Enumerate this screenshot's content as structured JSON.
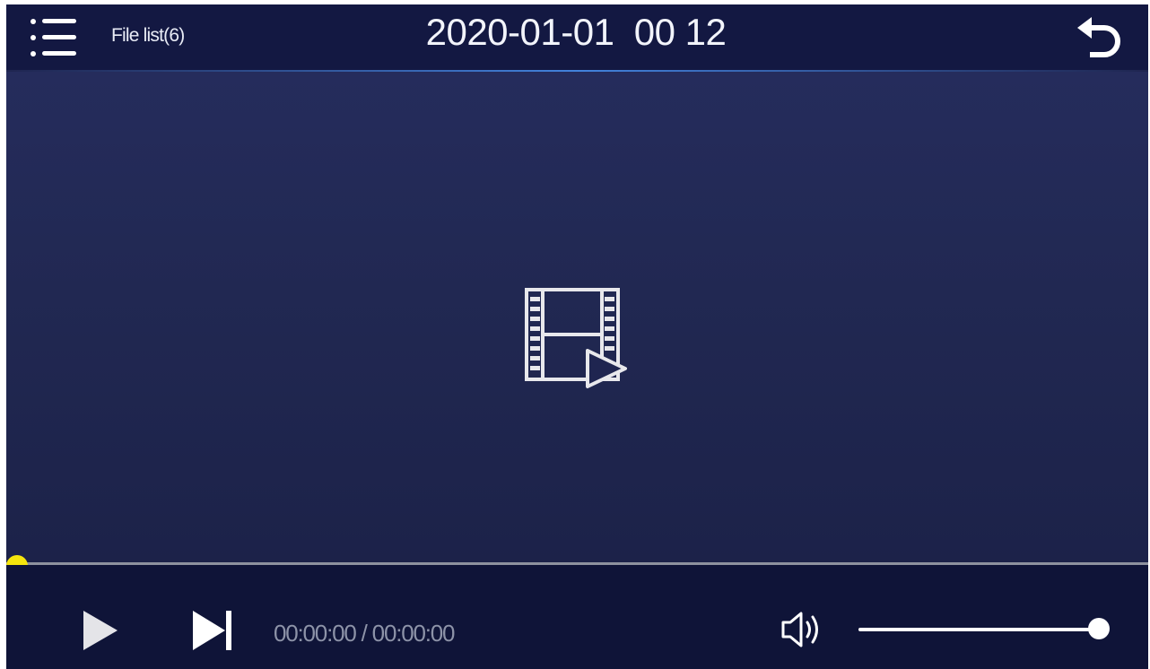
{
  "header": {
    "menu_icon": "list-menu-icon",
    "file_list_label": "File list(6)",
    "datetime": "2020-01-01  00 12",
    "back_icon": "return-arrow-icon"
  },
  "video": {
    "placeholder_icon": "film-play-icon"
  },
  "playback": {
    "progress": 0,
    "time_readout": "00:00:00 / 00:00:00",
    "play_icon": "play-icon",
    "next_icon": "skip-next-icon"
  },
  "volume": {
    "icon": "speaker-volume-icon",
    "level": 1.0
  },
  "colors": {
    "background": "#1f2550",
    "topbar": "#131842",
    "control_bar": "#0f1438",
    "progress_thumb": "#f5e50d",
    "time_text": "#8d93a8"
  }
}
